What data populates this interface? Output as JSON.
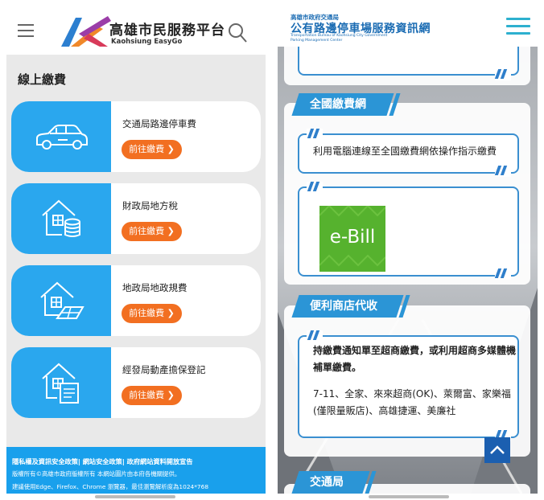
{
  "left": {
    "logo": {
      "title": "高雄市民服務平台",
      "subtitle": "Kaohsiung EasyGo"
    },
    "section_title": "線上繳費",
    "cards": [
      {
        "title": "交通局路邊停車費",
        "button": "前往繳費 ❯",
        "icon": "car-icon"
      },
      {
        "title": "財政局地方稅",
        "button": "前往繳費 ❯",
        "icon": "house-coins-icon"
      },
      {
        "title": "地政局地政規費",
        "button": "前往繳費 ❯",
        "icon": "house-land-icon"
      },
      {
        "title": "經發局動產擔保登記",
        "button": "前往繳費 ❯",
        "icon": "house-document-icon"
      }
    ],
    "footer": {
      "line1": "隱私權及資訊安全政策| 網站安全政策| 政府網站資料開放宣告",
      "line2": "版權所有©高雄市政府版權所有 本網站圖片由本府各機關提供。",
      "line3": "建議使用Edge、Firefox、Chrome 瀏覽器，最佳瀏覽解析度為1024*768"
    }
  },
  "right": {
    "header": {
      "line1": "高雄市政府交通局",
      "line2": "公有路邊停車場服務資訊網",
      "line3": "Transportation Bureau of Kaohsiung City Government",
      "line4": "Parking Management Center"
    },
    "sections": [
      {
        "tag": "全國繳費網",
        "text": "利用電腦連線至全國繳費網依操作指示繳費",
        "logo_text": "e-Bill"
      },
      {
        "tag": "便利商店代收",
        "bold_text": "持繳費通知單至超商繳費，或利用超商多媒體機補單繳費。",
        "text": "7-11、全家、來來超商(OK)、萊爾富、家樂福(僅限量販店)、高雄捷運、美廉社"
      },
      {
        "tag": "交通局"
      }
    ]
  },
  "colors": {
    "accent_blue": "#2aa7ee",
    "button_orange": "#f26f21",
    "tag_blue": "#2b95d6",
    "ebill_green": "#56b22e"
  }
}
